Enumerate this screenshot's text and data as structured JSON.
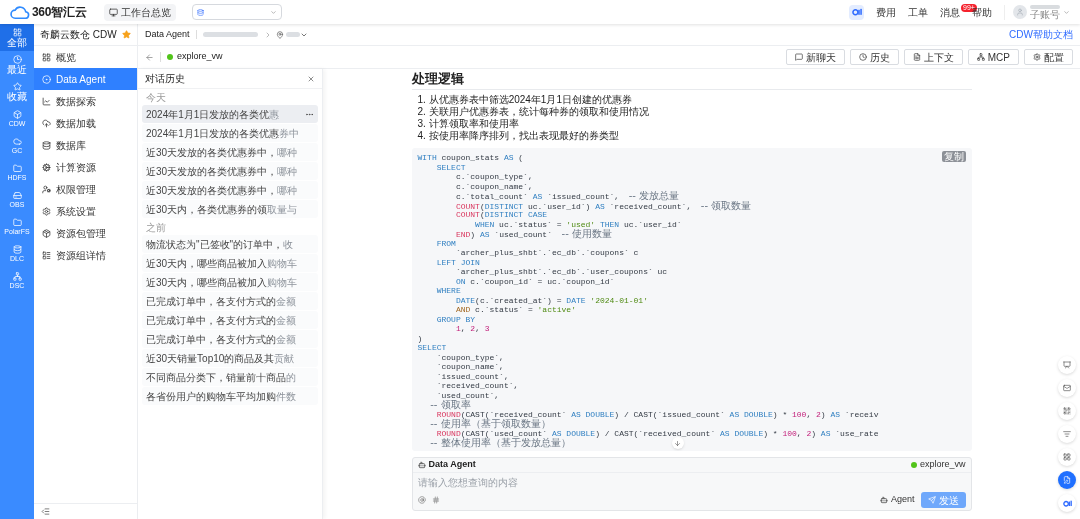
{
  "top_bar": {
    "logo": "360智汇云",
    "workspace_button": "工作台总览",
    "links": [
      {
        "label": "费用"
      },
      {
        "label": "工单"
      },
      {
        "label": "消息",
        "badge": "99+"
      },
      {
        "label": "帮助"
      }
    ],
    "account_role": "子账号"
  },
  "rail": [
    {
      "label": "全部",
      "selected": true
    },
    {
      "label": "最近",
      "selected": false
    },
    {
      "label": "收藏",
      "selected": false
    },
    {
      "label": "CDW",
      "selected": false
    },
    {
      "label": "GC",
      "selected": false
    },
    {
      "label": "HDFS",
      "selected": false
    },
    {
      "label": "OBS",
      "selected": false
    },
    {
      "label": "PolarFS",
      "selected": false
    },
    {
      "label": "DLC",
      "selected": false
    },
    {
      "label": "DSC",
      "selected": false
    }
  ],
  "sidebar": {
    "title": "奇麟云数仓 CDW",
    "starred": true,
    "items": [
      {
        "label": "概览",
        "selected": false
      },
      {
        "label": "Data Agent",
        "selected": true
      },
      {
        "label": "数据探索",
        "selected": false
      },
      {
        "label": "数据加载",
        "selected": false
      },
      {
        "label": "数据库",
        "selected": false
      },
      {
        "label": "计算资源",
        "selected": false
      },
      {
        "label": "权限管理",
        "selected": false
      },
      {
        "label": "系统设置",
        "selected": false
      },
      {
        "label": "资源包管理",
        "selected": false
      },
      {
        "label": "资源组详情",
        "selected": false
      }
    ]
  },
  "header": {
    "breadcrumb": "Data Agent",
    "help_link": "CDW帮助文档"
  },
  "toolbar": {
    "warehouse": "explore_vw",
    "buttons": [
      "新聊天",
      "历史",
      "上下文",
      "MCP",
      "配置"
    ]
  },
  "history": {
    "title": "对话历史",
    "groups": [
      {
        "label": "今天",
        "items": [
          {
            "text": "2024年1月1日发放的各类优",
            "tail": "惠",
            "selected": true
          },
          {
            "text": "2024年1月1日发放的各类优惠",
            "tail": "券中",
            "selected": false
          },
          {
            "text": "近30天发放的各类优惠券中，",
            "tail": "哪种",
            "selected": false
          },
          {
            "text": "近30天发放的各类优惠券中，",
            "tail": "哪种",
            "selected": false
          },
          {
            "text": "近30天发放的各类优惠券中，",
            "tail": "哪种",
            "selected": false
          },
          {
            "text": "近30天内，各类优惠券的领",
            "tail": "取量与",
            "selected": false
          }
        ]
      },
      {
        "label": "之前",
        "items": [
          {
            "text": "物流状态为\"已签收\"的订单中，",
            "tail": "收",
            "selected": false
          },
          {
            "text": "近30天内，哪些商品被加入",
            "tail": "购物车",
            "selected": false
          },
          {
            "text": "近30天内，哪些商品被加入",
            "tail": "购物车",
            "selected": false
          },
          {
            "text": "已完成订单中，各支付方式的",
            "tail": "金额",
            "selected": false
          },
          {
            "text": "已完成订单中，各支付方式的",
            "tail": "金额",
            "selected": false
          },
          {
            "text": "已完成订单中，各支付方式的",
            "tail": "金额",
            "selected": false
          },
          {
            "text": "近30天销量Top10的商品及其",
            "tail": "贡献",
            "selected": false
          },
          {
            "text": "不同商品分类下，销量前十商品",
            "tail": "的",
            "selected": false
          },
          {
            "text": "各省份用户的购物车平均加购",
            "tail": "件数",
            "selected": false
          }
        ]
      }
    ]
  },
  "answer": {
    "heading": "处理逻辑",
    "steps": [
      {
        "num": "1.",
        "text": "从优惠券表中筛选2024年1月1日创建的优惠券"
      },
      {
        "num": "2.",
        "text": "关联用户优惠券表，统计每种券的领取和使用情况"
      },
      {
        "num": "3.",
        "text": "计算领取率和使用率"
      },
      {
        "num": "4.",
        "text": "按使用率降序排列，找出表现最好的券类型"
      }
    ],
    "copy_label": "复制",
    "code": [
      [
        {
          "kind": "kw",
          "text": "WITH"
        },
        {
          "kind": "p",
          "text": " coupon_stats "
        },
        {
          "kind": "kw",
          "text": "AS"
        },
        {
          "kind": "p",
          "text": " ("
        }
      ],
      [
        {
          "kind": "kw",
          "text": "    SELECT"
        }
      ],
      [
        {
          "kind": "p",
          "text": "        c.`coupon_type`,"
        }
      ],
      [
        {
          "kind": "p",
          "text": "        c.`coupon_name`,"
        }
      ],
      [
        {
          "kind": "p",
          "text": "        c.`total_count` "
        },
        {
          "kind": "kw",
          "text": "AS"
        },
        {
          "kind": "p",
          "text": " `issued_count`,  "
        },
        {
          "kind": "cm",
          "text": "-- 发放总量"
        }
      ],
      [
        {
          "kind": "fn",
          "text": "        COUNT"
        },
        {
          "kind": "p",
          "text": "("
        },
        {
          "kind": "kw",
          "text": "DISTINCT"
        },
        {
          "kind": "p",
          "text": " uc.`user_id`) "
        },
        {
          "kind": "kw",
          "text": "AS"
        },
        {
          "kind": "p",
          "text": " `received_count`,  "
        },
        {
          "kind": "cm",
          "text": "-- 领取数量"
        }
      ],
      [
        {
          "kind": "fn",
          "text": "        COUNT"
        },
        {
          "kind": "p",
          "text": "("
        },
        {
          "kind": "kw",
          "text": "DISTINCT CASE"
        }
      ],
      [
        {
          "kind": "kw",
          "text": "            WHEN"
        },
        {
          "kind": "p",
          "text": " uc.`status` = "
        },
        {
          "kind": "str",
          "text": "'used'"
        },
        {
          "kind": "kw",
          "text": " THEN"
        },
        {
          "kind": "p",
          "text": " uc.`user_id`"
        }
      ],
      [
        {
          "kind": "fn",
          "text": "        END"
        },
        {
          "kind": "p",
          "text": ") "
        },
        {
          "kind": "kw",
          "text": "AS"
        },
        {
          "kind": "p",
          "text": " `used_count`  "
        },
        {
          "kind": "cm",
          "text": "-- 使用数量"
        }
      ],
      [
        {
          "kind": "kw",
          "text": "    FROM"
        }
      ],
      [
        {
          "kind": "p",
          "text": "        `archer_plus_shbt`.`ec_db`.`coupons` c"
        }
      ],
      [
        {
          "kind": "kw",
          "text": "    LEFT JOIN"
        }
      ],
      [
        {
          "kind": "p",
          "text": "        `archer_plus_shbt`.`ec_db`.`user_coupons` uc"
        }
      ],
      [
        {
          "kind": "kw",
          "text": "        ON"
        },
        {
          "kind": "p",
          "text": " c.`coupon_id` = uc.`coupon_id`"
        }
      ],
      [
        {
          "kind": "kw",
          "text": "    WHERE"
        }
      ],
      [
        {
          "kind": "kw",
          "text": "        DATE"
        },
        {
          "kind": "p",
          "text": "(c.`created_at`) = "
        },
        {
          "kind": "kw",
          "text": "DATE "
        },
        {
          "kind": "str",
          "text": "'2024-01-01'"
        }
      ],
      [
        {
          "kind": "op",
          "text": "        AND"
        },
        {
          "kind": "p",
          "text": " c.`status` = "
        },
        {
          "kind": "str",
          "text": "'active'"
        }
      ],
      [
        {
          "kind": "kw",
          "text": "    GROUP BY"
        }
      ],
      [
        {
          "kind": "num",
          "text": "        1"
        },
        {
          "kind": "p",
          "text": ", "
        },
        {
          "kind": "num",
          "text": "2"
        },
        {
          "kind": "p",
          "text": ", "
        },
        {
          "kind": "num",
          "text": "3"
        }
      ],
      [
        {
          "kind": "p",
          "text": ")"
        }
      ],
      [
        {
          "kind": "kw",
          "text": "SELECT"
        }
      ],
      [
        {
          "kind": "p",
          "text": "    `coupon_type`,"
        }
      ],
      [
        {
          "kind": "p",
          "text": "    `coupon_name`,"
        }
      ],
      [
        {
          "kind": "p",
          "text": "    `issued_count`,"
        }
      ],
      [
        {
          "kind": "p",
          "text": "    `received_count`,"
        }
      ],
      [
        {
          "kind": "p",
          "text": "    `used_count`,"
        }
      ],
      [
        {
          "kind": "cm",
          "text": "    -- 领取率"
        }
      ],
      [
        {
          "kind": "fn",
          "text": "    ROUND"
        },
        {
          "kind": "p",
          "text": "(CAST(`received_count` "
        },
        {
          "kind": "kw",
          "text": "AS DOUBLE"
        },
        {
          "kind": "p",
          "text": ") / CAST(`issued_count` "
        },
        {
          "kind": "kw",
          "text": "AS DOUBLE"
        },
        {
          "kind": "p",
          "text": ") * "
        },
        {
          "kind": "num",
          "text": "100"
        },
        {
          "kind": "p",
          "text": ", "
        },
        {
          "kind": "num",
          "text": "2"
        },
        {
          "kind": "p",
          "text": ") "
        },
        {
          "kind": "kw",
          "text": "AS"
        },
        {
          "kind": "p",
          "text": " `receiv"
        }
      ],
      [
        {
          "kind": "cm",
          "text": "    -- 使用率（基于领取数量）"
        }
      ],
      [
        {
          "kind": "fn",
          "text": "    ROUND"
        },
        {
          "kind": "p",
          "text": "(CAST(`used_count` "
        },
        {
          "kind": "kw",
          "text": "AS DOUBLE"
        },
        {
          "kind": "p",
          "text": ") / CAST(`received_count` "
        },
        {
          "kind": "kw",
          "text": "AS DOUBLE"
        },
        {
          "kind": "p",
          "text": ") * "
        },
        {
          "kind": "num",
          "text": "100"
        },
        {
          "kind": "p",
          "text": ", "
        },
        {
          "kind": "num",
          "text": "2"
        },
        {
          "kind": "p",
          "text": ") "
        },
        {
          "kind": "kw",
          "text": "AS"
        },
        {
          "kind": "p",
          "text": " `use_rate"
        }
      ],
      [
        {
          "kind": "cm",
          "text": "    -- 整体使用率（基于发放总量）"
        }
      ]
    ]
  },
  "composer": {
    "title": "Data Agent",
    "warehouse": "explore_vw",
    "placeholder": "请输入您想查询的内容",
    "mode": "Agent",
    "send": "发送",
    "send_disabled": true
  },
  "float_buttons": [
    {
      "selected": false
    },
    {
      "selected": false
    },
    {
      "selected": false
    },
    {
      "selected": false
    },
    {
      "selected": false
    },
    {
      "selected": true
    },
    {
      "selected": false
    }
  ]
}
